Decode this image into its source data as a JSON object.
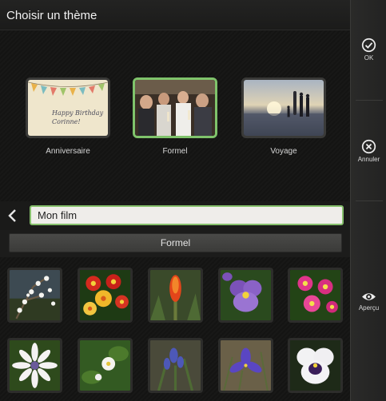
{
  "header": {
    "title": "Choisir un thème"
  },
  "actions": [
    {
      "label": "OK",
      "icon": "check-circle-icon"
    },
    {
      "label": "Annuler",
      "icon": "cancel-circle-icon"
    },
    {
      "label": "Aperçu",
      "icon": "eye-icon"
    }
  ],
  "themes": [
    {
      "label": "Anniversaire",
      "selected": false,
      "card_text": "Happy Birthday\nCorinne!"
    },
    {
      "label": "Formel",
      "selected": true
    },
    {
      "label": "Voyage",
      "selected": false
    }
  ],
  "movie": {
    "name": "Mon film"
  },
  "theme_select": {
    "value": "Formel"
  },
  "photos": [
    {
      "subject": "white-branch-blossoms"
    },
    {
      "subject": "red-yellow-primulas"
    },
    {
      "subject": "red-aloe-flower"
    },
    {
      "subject": "purple-pansy"
    },
    {
      "subject": "pink-primulas"
    },
    {
      "subject": "white-daisy"
    },
    {
      "subject": "white-flower-leaves"
    },
    {
      "subject": "blue-grape-hyacinth"
    },
    {
      "subject": "blue-iris"
    },
    {
      "subject": "white-purple-pansy"
    }
  ],
  "colors": {
    "accent": "#86c06c",
    "background": "#0e0e0d"
  }
}
